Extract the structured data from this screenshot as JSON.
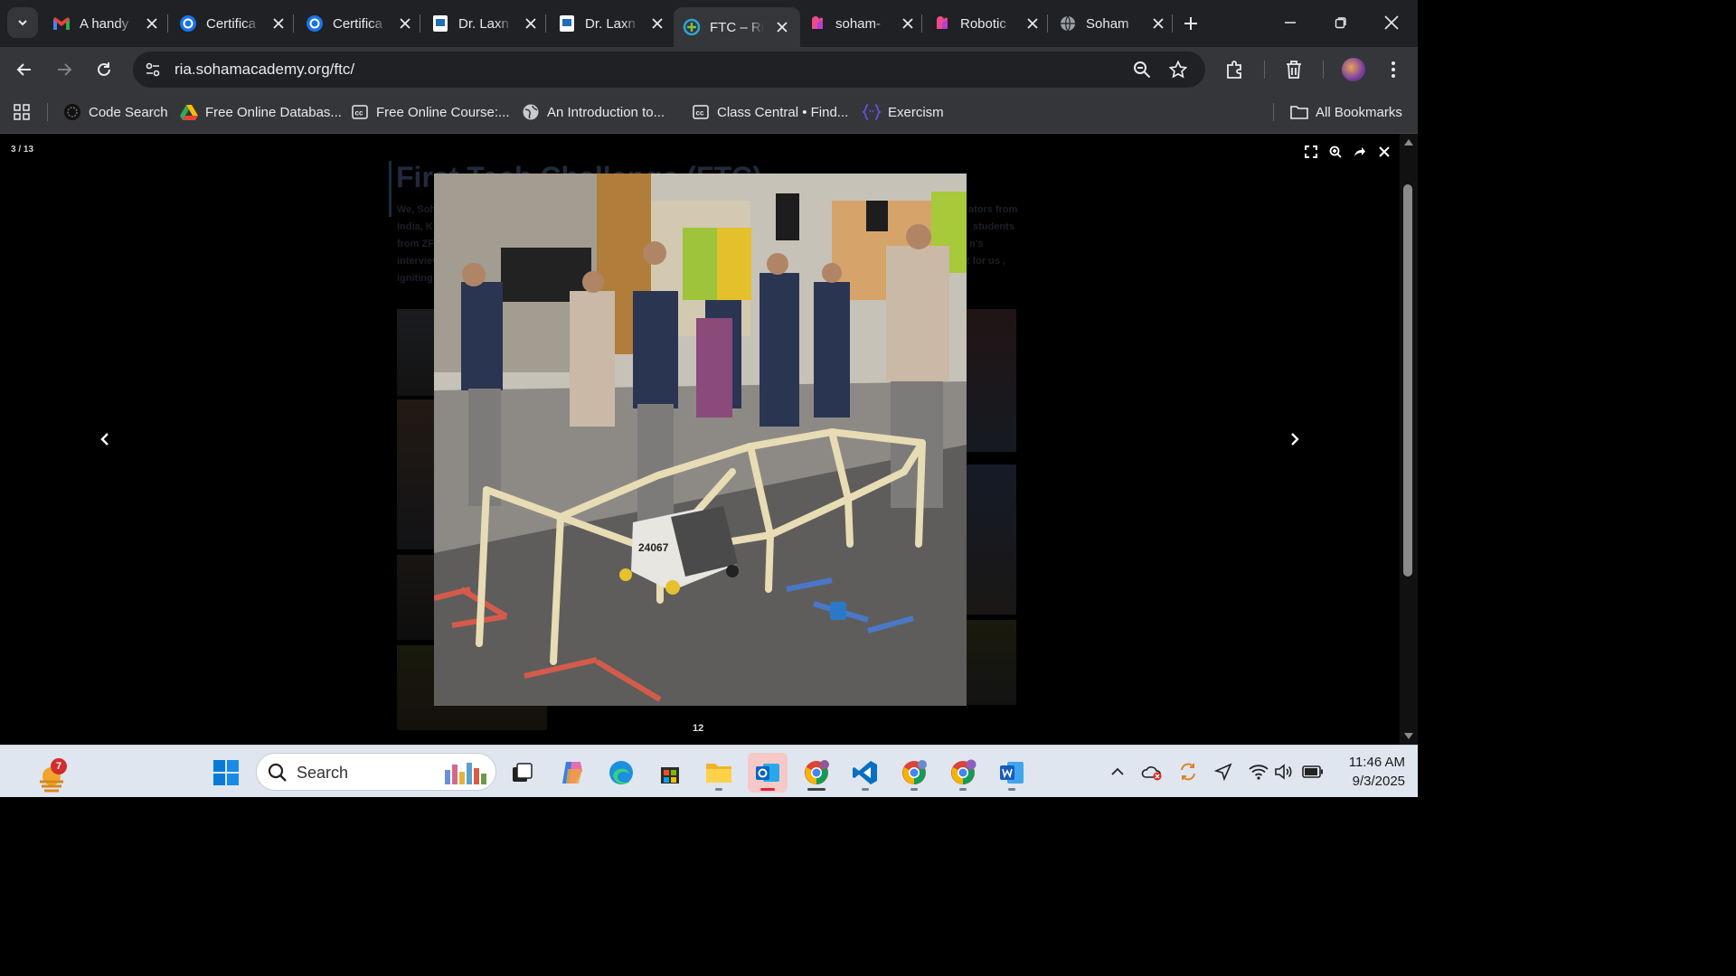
{
  "tabs": [
    {
      "label": "A handy",
      "icon": "gmail-icon"
    },
    {
      "label": "Certifica",
      "icon": "coursera-badge-icon"
    },
    {
      "label": "Certifica",
      "icon": "coursera-badge-icon"
    },
    {
      "label": "Dr. Laxn",
      "icon": "doc-icon"
    },
    {
      "label": "Dr. Laxn",
      "icon": "doc-icon"
    },
    {
      "label": "FTC – Ri",
      "icon": "robotics-academy-icon",
      "active": true
    },
    {
      "label": "soham-",
      "icon": "pink-app-icon"
    },
    {
      "label": "Robotic",
      "icon": "pink-app-icon"
    },
    {
      "label": "Soham",
      "icon": "globe-icon"
    }
  ],
  "address_bar": {
    "url": "ria.sohamacademy.org/ftc/"
  },
  "bookmarks": [
    {
      "label": "Code Search",
      "icon": "code-search-icon"
    },
    {
      "label": "Free Online Databas...",
      "icon": "google-drive-icon"
    },
    {
      "label": "Free Online Course:...",
      "icon": "class-central-icon"
    },
    {
      "label": "An Introduction to...",
      "icon": "globe-icon"
    },
    {
      "label": "Class Central • Find...",
      "icon": "class-central-icon"
    },
    {
      "label": "Exercism",
      "icon": "exercism-icon"
    }
  ],
  "all_bookmarks_label": "All Bookmarks",
  "lightbox": {
    "counter": "3 / 13",
    "caption": "12",
    "controls": [
      "fullscreen-icon",
      "zoom-icon",
      "share-icon",
      "close-icon"
    ],
    "photo_alt": "Robot labeled 24067 driving under a PVC pipe frame on a competition field with people in the background",
    "robot_number": "24067"
  },
  "background_page": {
    "title": "First Tech Challenge (FTC)",
    "paragraph_lines": [
      {
        "left": "We, Soh",
        "right": "ators from"
      },
      {
        "left": "India, K",
        "right": "students"
      },
      {
        "left": "from ZF",
        "right": "n's"
      },
      {
        "left": "interviev",
        "right": "nt for us ,"
      },
      {
        "left": "igniting",
        "right": ""
      }
    ]
  },
  "taskbar": {
    "search_label": "Search",
    "weather_badge": "7",
    "time": "11:46 AM",
    "date": "9/3/2025"
  },
  "colors": {
    "chrome_dark": "#202124",
    "chrome_mid": "#35363a",
    "taskbar": "#dfe6ef",
    "accent_blue": "#1a73e8"
  }
}
